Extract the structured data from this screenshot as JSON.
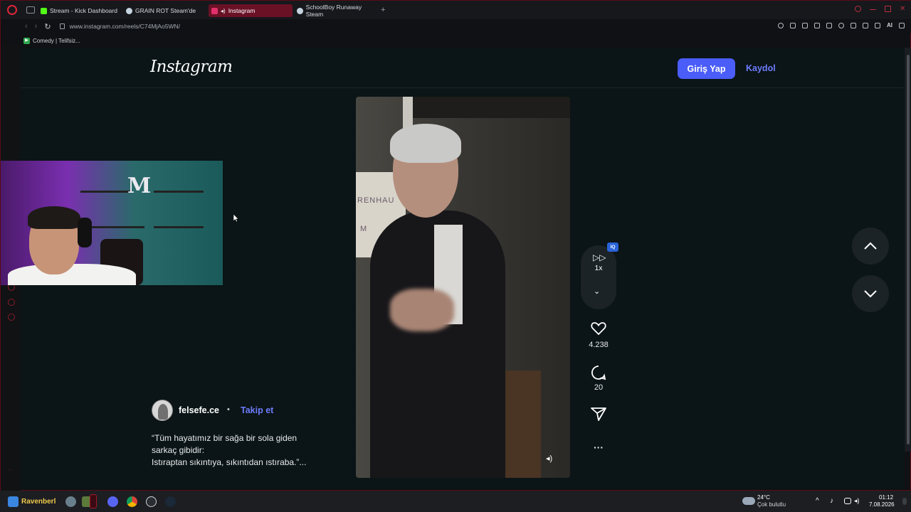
{
  "browser": {
    "tabs": [
      {
        "label": "Stream - Kick Dashboard",
        "color": "#53fc18"
      },
      {
        "label": "GRAIN ROT Steam'de",
        "color": "#c7d5e0"
      },
      {
        "label": "Instagram",
        "color": "#e1306c"
      },
      {
        "label": "SchoolBoy Runaway Steam",
        "color": "#c7d5e0"
      }
    ],
    "url": "www.instagram.com/reels/C74MjAo5WN/",
    "bookmark": "Comedy | Telifsiz...",
    "ai_label": "AI"
  },
  "instagram": {
    "logo": "Instagram",
    "login_label": "Giriş Yap",
    "signup_label": "Kaydol",
    "speed_label": "1x",
    "iq_badge": "IQ",
    "likes": "4.238",
    "comments": "20",
    "author": "felsefe.ce",
    "separator": "•",
    "follow_label": "Takip et",
    "caption_line1": "“Tüm hayatımız bir sağa bir sola giden",
    "caption_line2": "sarkaç gibidir:",
    "caption_line3": "Istıraptan sıkıntıya, sıkıntıdan ıstıraba.”...",
    "video_board_text": "RENHAU",
    "video_board_text2": "M"
  },
  "taskbar": {
    "user_label": "Ravenberl",
    "weather_temp": "24°C",
    "weather_desc": "Çok bulutlu",
    "time": "01:12",
    "date": "7.08.2026"
  },
  "colors": {
    "accent_blue": "#4a5df9",
    "link_blue": "#6c7cfb",
    "opera_red": "#e0253b"
  }
}
